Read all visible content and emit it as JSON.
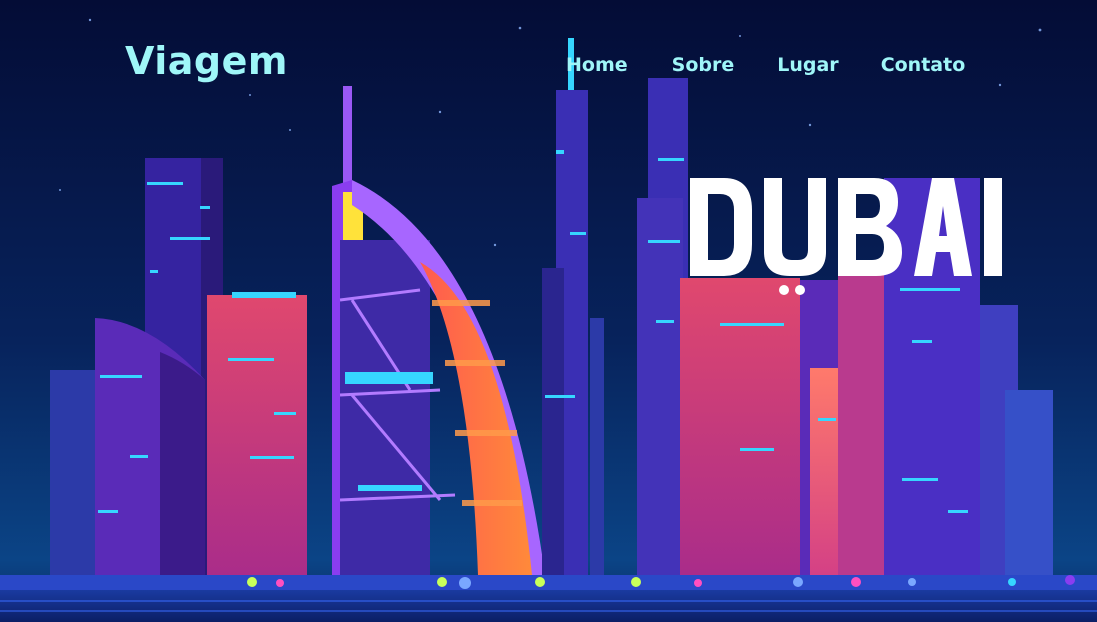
{
  "brand": {
    "name": "Viagem"
  },
  "nav": {
    "items": [
      {
        "label": "Home"
      },
      {
        "label": "Sobre"
      },
      {
        "label": "Lugar"
      },
      {
        "label": "Contato"
      }
    ]
  },
  "hero": {
    "city_title": "DUBAI",
    "illustration": "dubai-skyline-neon-night"
  },
  "colors": {
    "accent_text": "#9ff6f8",
    "sky_top": "#050f3d",
    "sky_bottom": "#0a3a7a",
    "neon_pink": "#ff4f7b",
    "neon_purple": "#8a3df0",
    "neon_cyan": "#36d6ff"
  }
}
